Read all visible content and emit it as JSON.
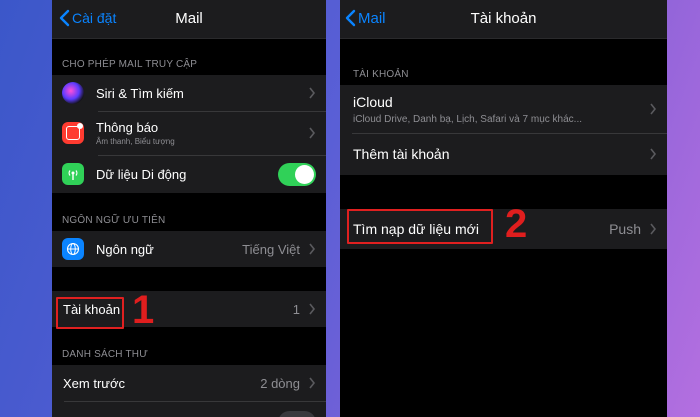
{
  "left_screen": {
    "back_label": "Cài đặt",
    "title": "Mail",
    "section1_header": "CHO PHÉP MAIL TRUY CẬP",
    "siri_label": "Siri & Tìm kiếm",
    "notifications_label": "Thông báo",
    "notifications_sub": "Âm thanh, Biểu tượng",
    "cellular_label": "Dữ liệu Di động",
    "cellular_on": true,
    "section2_header": "NGÔN NGỮ ƯU TIÊN",
    "language_label": "Ngôn ngữ",
    "language_value": "Tiếng Việt",
    "accounts_label": "Tài khoản",
    "accounts_value": "1",
    "section3_header": "DANH SÁCH THƯ",
    "preview_label": "Xem trước",
    "preview_value": "2 dòng"
  },
  "right_screen": {
    "back_label": "Mail",
    "title": "Tài khoản",
    "section_header": "TÀI KHOẢN",
    "icloud_label": "iCloud",
    "icloud_sub": "iCloud Drive, Danh bạ, Lịch, Safari và 7 mục khác...",
    "add_account_label": "Thêm tài khoản",
    "fetch_label": "Tìm nạp dữ liệu mới",
    "fetch_value": "Push"
  },
  "annotations": {
    "step1": "1",
    "step2": "2",
    "highlight_color": "#e02020"
  },
  "colors": {
    "accent": "#0a84ff",
    "toggle_on": "#30d158"
  }
}
